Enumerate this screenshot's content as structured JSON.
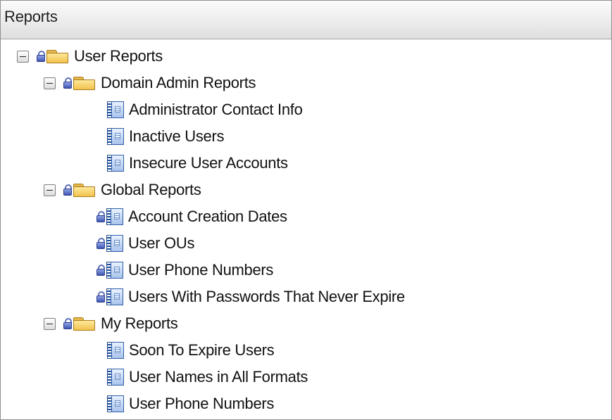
{
  "panel": {
    "title": "Reports"
  },
  "tree": {
    "root": {
      "label": "User Reports",
      "groups": [
        {
          "label": "Domain Admin Reports",
          "items": [
            {
              "label": "Administrator Contact Info"
            },
            {
              "label": "Inactive Users"
            },
            {
              "label": "Insecure User Accounts"
            }
          ]
        },
        {
          "label": "Global Reports",
          "items": [
            {
              "label": "Account Creation Dates"
            },
            {
              "label": "User OUs"
            },
            {
              "label": "User Phone Numbers"
            },
            {
              "label": "Users With Passwords That Never Expire"
            }
          ]
        },
        {
          "label": "My Reports",
          "items": [
            {
              "label": "Soon To Expire Users"
            },
            {
              "label": "User Names in All Formats"
            },
            {
              "label": "User Phone Numbers"
            }
          ]
        }
      ]
    }
  },
  "icons": {
    "toggle": "collapse-minus-icon",
    "lock": "lock-icon",
    "folder": "folder-icon",
    "report": "report-icon"
  },
  "colors": {
    "lock": "#3e56b2",
    "folder": "#f2c24e",
    "report": "#2f5ea8",
    "header_bg": "#ececec"
  }
}
